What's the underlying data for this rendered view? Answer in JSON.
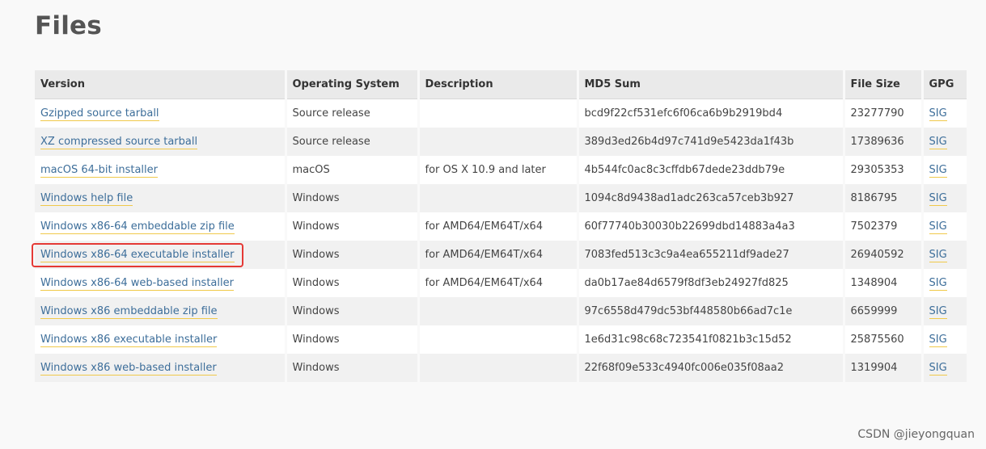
{
  "page": {
    "title": "Files"
  },
  "table": {
    "headers": [
      "Version",
      "Operating System",
      "Description",
      "MD5 Sum",
      "File Size",
      "GPG"
    ],
    "rows": [
      {
        "version": "Gzipped source tarball",
        "os": "Source release",
        "description": "",
        "md5": "bcd9f22cf531efc6f06ca6b9b2919bd4",
        "size": "23277790",
        "gpg": "SIG"
      },
      {
        "version": "XZ compressed source tarball",
        "os": "Source release",
        "description": "",
        "md5": "389d3ed26b4d97c741d9e5423da1f43b",
        "size": "17389636",
        "gpg": "SIG"
      },
      {
        "version": "macOS 64-bit installer",
        "os": "macOS",
        "description": "for OS X 10.9 and later",
        "md5": "4b544fc0ac8c3cffdb67dede23ddb79e",
        "size": "29305353",
        "gpg": "SIG"
      },
      {
        "version": "Windows help file",
        "os": "Windows",
        "description": "",
        "md5": "1094c8d9438ad1adc263ca57ceb3b927",
        "size": "8186795",
        "gpg": "SIG"
      },
      {
        "version": "Windows x86-64 embeddable zip file",
        "os": "Windows",
        "description": "for AMD64/EM64T/x64",
        "md5": "60f77740b30030b22699dbd14883a4a3",
        "size": "7502379",
        "gpg": "SIG"
      },
      {
        "version": "Windows x86-64 executable installer",
        "os": "Windows",
        "description": "for AMD64/EM64T/x64",
        "md5": "7083fed513c3c9a4ea655211df9ade27",
        "size": "26940592",
        "gpg": "SIG"
      },
      {
        "version": "Windows x86-64 web-based installer",
        "os": "Windows",
        "description": "for AMD64/EM64T/x64",
        "md5": "da0b17ae84d6579f8df3eb24927fd825",
        "size": "1348904",
        "gpg": "SIG"
      },
      {
        "version": "Windows x86 embeddable zip file",
        "os": "Windows",
        "description": "",
        "md5": "97c6558d479dc53bf448580b66ad7c1e",
        "size": "6659999",
        "gpg": "SIG"
      },
      {
        "version": "Windows x86 executable installer",
        "os": "Windows",
        "description": "",
        "md5": "1e6d31c98c68c723541f0821b3c15d52",
        "size": "25875560",
        "gpg": "SIG"
      },
      {
        "version": "Windows x86 web-based installer",
        "os": "Windows",
        "description": "",
        "md5": "22f68f09e533c4940fc006e035f08aa2",
        "size": "1319904",
        "gpg": "SIG"
      }
    ]
  },
  "highlight": {
    "color": "#e53935"
  },
  "colors": {
    "link": "#3d6e9a",
    "link_underline": "#f0c94a",
    "header_bg": "#eaeaea"
  },
  "watermark": {
    "text": "CSDN @jieyongquan"
  }
}
